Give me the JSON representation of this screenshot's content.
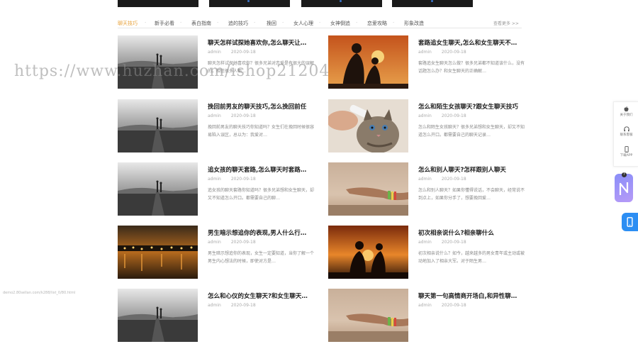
{
  "tabs": {
    "items": [
      "聊天技巧",
      "新手必看",
      "表白指南",
      "追的技巧",
      "挽回",
      "女人心理",
      "女神倒追",
      "恋爱攻略",
      "形象改造"
    ],
    "active_index": 0,
    "more_label": "查看更多 >>"
  },
  "articles": [
    {
      "title": "聊天怎样试探她喜欢你,怎么聊天让…",
      "author": "admin",
      "date": "2020-09-18",
      "excerpt": "聊天怎样试探她喜欢你？很多兄弟对恋爱是有很大的误解的，相信很多人都…",
      "thumb": "road"
    },
    {
      "title": "套路追女生聊天,怎么和女生聊天不…",
      "author": "admin",
      "date": "2020-09-18",
      "excerpt": "套路追女生聊天怎么做？很多兄弟都不知道该什么，没有话题怎么办？和女生聊天的正确解…",
      "thumb": "sunset-couple"
    },
    {
      "title": "挽回前男友的聊天技巧,怎么挽回前任",
      "author": "admin",
      "date": "2020-09-18",
      "excerpt": "挽回前男友的聊天技巧你知道吗？女生们在挽回时候很容易陷入误区，总以为：我爱对…",
      "thumb": "road"
    },
    {
      "title": "怎么和陌生女孩聊天?跟女生聊天技巧",
      "author": "admin",
      "date": "2020-09-18",
      "excerpt": "怎么和陌生女孩聊天？很多兄弟想和女生聊天，却又不知道怎么开口。都需要自己的聊天记录…",
      "thumb": "kitten"
    },
    {
      "title": "追女孩的聊天套路,怎么聊天时套路…",
      "author": "admin",
      "date": "2020-09-18",
      "excerpt": "追女孩的聊天套路你知道吗？很多兄弟想和女生聊天，却又不知道怎么开口。都需要自己的聊…",
      "thumb": "road"
    },
    {
      "title": "怎么和别人聊天?怎样跟别人聊天",
      "author": "admin",
      "date": "2020-09-18",
      "excerpt": "怎么和别人聊天？如果你懂得说话，不会聊天，经常说不到点上，如果你分手了，想要挽回爱…",
      "thumb": "hand"
    },
    {
      "title": "男生暗示想追你的表现,男人什么行…",
      "author": "admin",
      "date": "2020-09-18",
      "excerpt": "男生暗示想追你的表现，女生一定要知道，当你了解一个男生内心想法的时候，即使对方是…",
      "thumb": "city-night"
    },
    {
      "title": "初次相亲说什么?相亲聊什么",
      "author": "admin",
      "date": "2020-09-18",
      "excerpt": "初次相亲说什么？如今，越来越多的男女青年或主动或被动地加入了相亲大军。对于陌生男…",
      "thumb": "sunset-couple2"
    },
    {
      "title": "怎么和心仪的女生聊天?和女生聊天…",
      "author": "admin",
      "date": "2020-09-18",
      "excerpt": "",
      "thumb": "road"
    },
    {
      "title": "聊天第一句高情商开场白,和异性聊…",
      "author": "admin",
      "date": "2020-09-18",
      "excerpt": "",
      "thumb": "hand"
    }
  ],
  "watermark": "https://www.huzhan.com/ishop21204",
  "status_url": "demo2.80sellan.com/k288/list_0/80.html",
  "sidebar": {
    "items": [
      {
        "label": "关于我们",
        "icon": "apple-icon"
      },
      {
        "label": "联系客服",
        "icon": "headset-icon"
      },
      {
        "label": "下载APP",
        "icon": "phone-icon"
      }
    ]
  },
  "colors": {
    "accent": "#e7a13a",
    "phone_button": "#2c8ef3",
    "float_gradient_start": "#8a8ef8",
    "float_gradient_end": "#b69af7"
  }
}
